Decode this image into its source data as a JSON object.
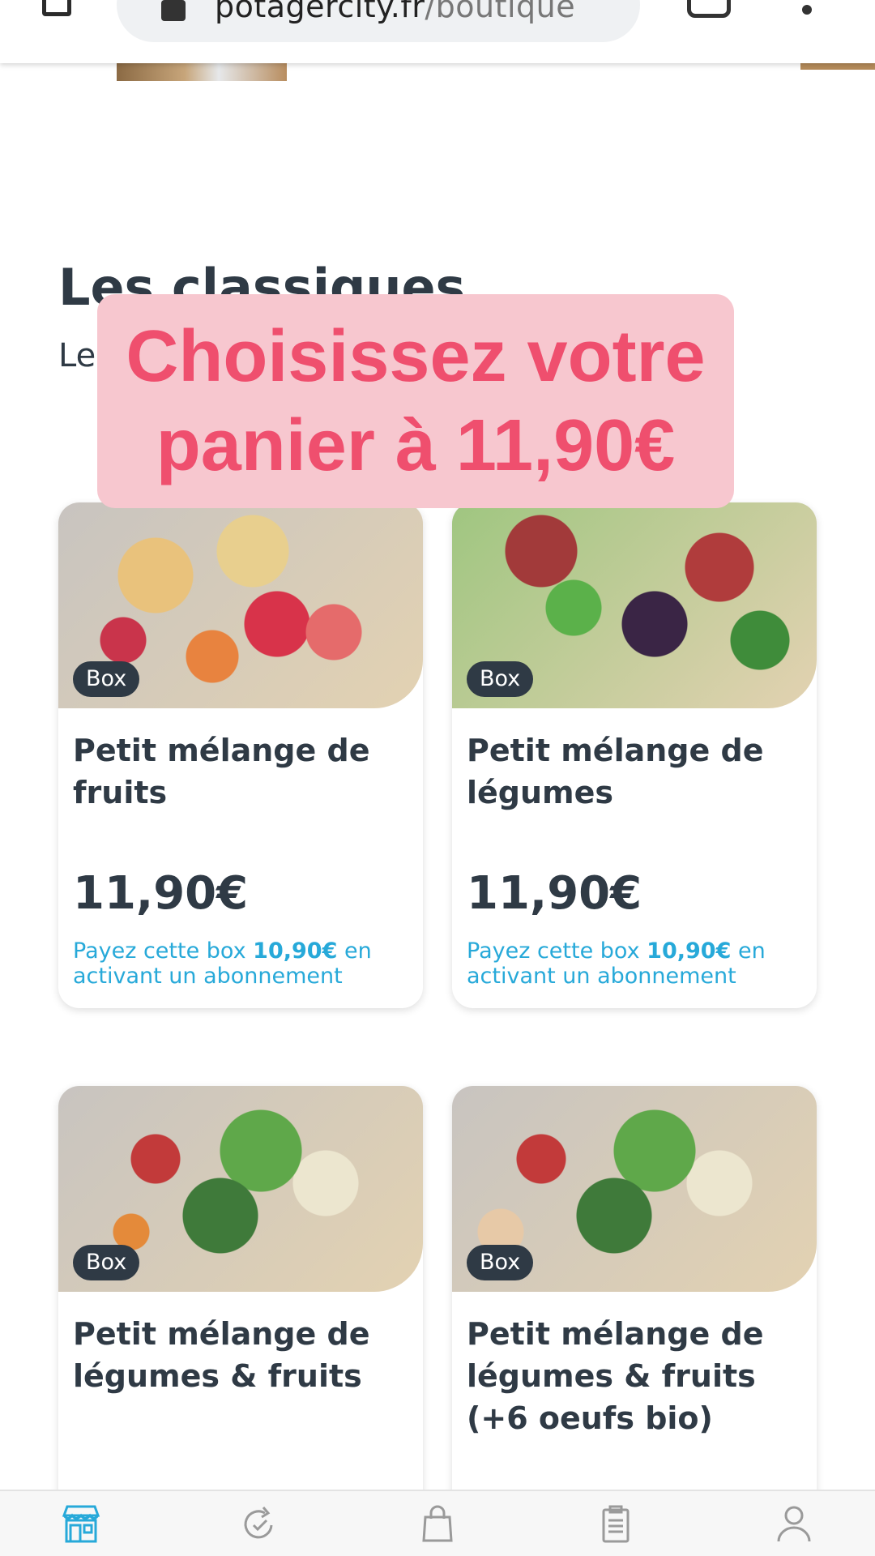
{
  "browser": {
    "url_host": "potagercity.fr",
    "url_path": "/boutique",
    "icons": [
      "tab-icon",
      "lock-icon",
      "tabs-icon",
      "menu-icon"
    ]
  },
  "section": {
    "title": "Les classiques",
    "subtitle": "Le"
  },
  "banner": {
    "line1": "Choisissez votre",
    "line2": "panier à 11,90€"
  },
  "products": [
    {
      "badge": "Box",
      "title": "Petit mélange de fruits",
      "price": "11,90€",
      "promo_before": "Payez cette box ",
      "promo_amount": "10,90€",
      "promo_after": " en activant un abonnement"
    },
    {
      "badge": "Box",
      "title": "Petit mélange de légumes",
      "price": "11,90€",
      "promo_before": "Payez cette box ",
      "promo_amount": "10,90€",
      "promo_after": " en activant un abonnement"
    },
    {
      "badge": "Box",
      "title": "Petit mélange de légumes & fruits"
    },
    {
      "badge": "Box",
      "title": "Petit mélange de légumes & fruits (+6 oeufs bio)"
    }
  ],
  "bottom_nav": {
    "items": [
      "shop-icon",
      "subscription-refresh-icon",
      "bag-icon",
      "orders-clipboard-icon",
      "account-user-icon"
    ],
    "active_color": "#27a9d9",
    "inactive_color": "#9a9a9a"
  }
}
